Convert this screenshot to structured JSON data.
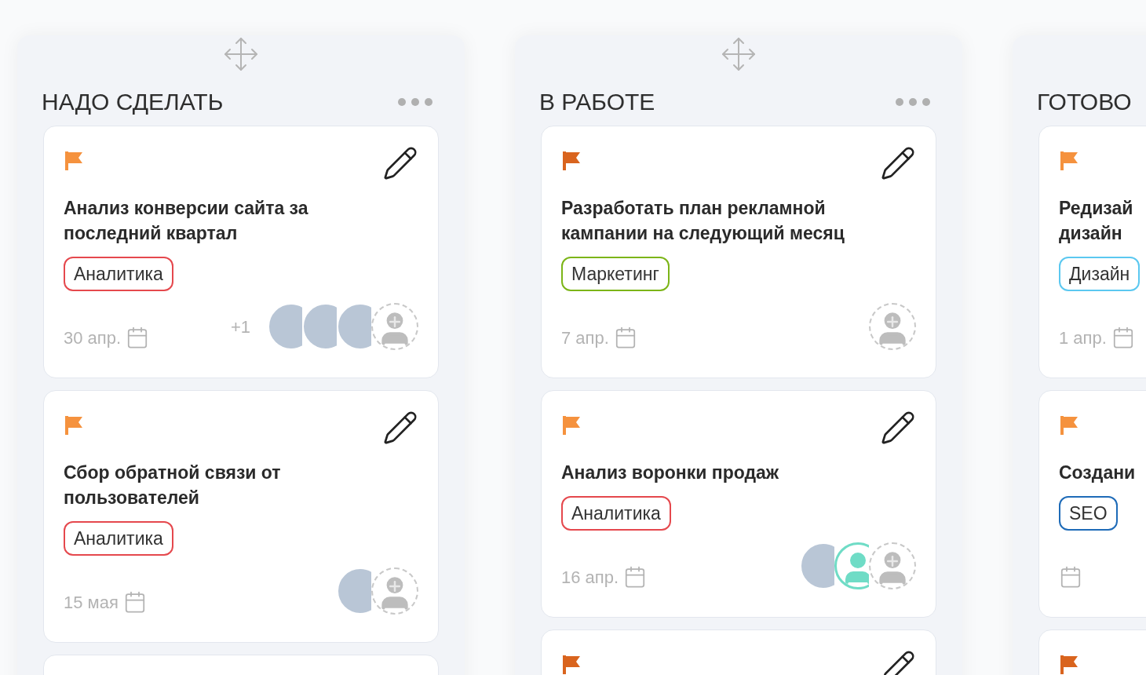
{
  "columns": [
    {
      "title": "НАДО СДЕЛАТЬ",
      "cards": [
        {
          "kind": "task",
          "flag": {
            "color": "#f5923e"
          },
          "title": "Анализ конверсии сайта за\nпоследний квартал",
          "tag": {
            "label": "Аналитика",
            "color": "#e5484d"
          },
          "date": "30 апр.",
          "extra_count": "+1",
          "avatars": [
            {
              "kind": "photo"
            },
            {
              "kind": "photo"
            },
            {
              "kind": "photo"
            },
            {
              "kind": "add"
            }
          ]
        },
        {
          "kind": "task",
          "flag": {
            "color": "#f5923e"
          },
          "title": "Сбор обратной связи от\nпользователей",
          "tag": {
            "label": "Аналитика",
            "color": "#e5484d"
          },
          "date": "15 мая",
          "avatars": [
            {
              "kind": "photo"
            },
            {
              "kind": "add"
            }
          ]
        },
        {
          "kind": "stub"
        }
      ]
    },
    {
      "title": "В РАБОТЕ",
      "cards": [
        {
          "kind": "task",
          "flag": {
            "color": "#d9641e"
          },
          "title": "Разработать план рекламной\nкампании на следующий месяц",
          "tag": {
            "label": "Маркетинг",
            "color": "#7cb518"
          },
          "date": "7 апр.",
          "avatars": [
            {
              "kind": "add"
            }
          ]
        },
        {
          "kind": "task",
          "flag": {
            "color": "#f5923e"
          },
          "title": "Анализ воронки продаж",
          "tag": {
            "label": "Аналитика",
            "color": "#e5484d"
          },
          "date": "16 апр.",
          "avatars": [
            {
              "kind": "photo"
            },
            {
              "kind": "person"
            },
            {
              "kind": "add"
            }
          ]
        },
        {
          "kind": "stub",
          "flag": {
            "color": "#d9641e"
          }
        }
      ]
    },
    {
      "title": "ГОТОВО",
      "cards": [
        {
          "kind": "task",
          "flag": {
            "color": "#f5923e"
          },
          "title": "Редизай\nдизайн",
          "tag": {
            "label": "Дизайн",
            "color": "#5bc8f0"
          },
          "date": "1 апр."
        },
        {
          "kind": "task",
          "flag": {
            "color": "#f5923e"
          },
          "title": "Создани",
          "tag": {
            "label": "SEO",
            "color": "#1e6bb8"
          }
        },
        {
          "kind": "stub",
          "flag": {
            "color": "#d9641e"
          }
        }
      ]
    }
  ]
}
